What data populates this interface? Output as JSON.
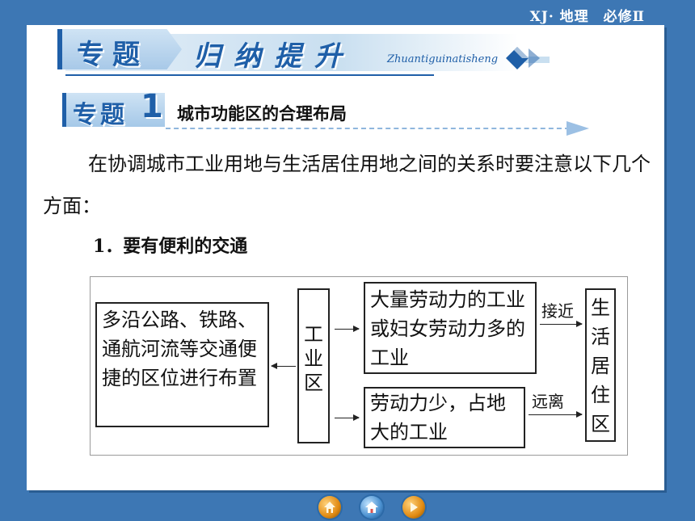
{
  "header": {
    "course_label": "XJ· 地理　必修Ⅱ"
  },
  "banner": {
    "tab": "专题",
    "title": "归纳提升",
    "pinyin": "Zhuantiguinatisheng"
  },
  "section": {
    "tab": "专题",
    "number": "1",
    "title": "城市功能区的合理布局"
  },
  "intro": "在协调城市工业用地与生活居住用地之间的关系时要注意以下几个方面：",
  "point": "1．要有便利的交通",
  "diagram": {
    "left_box": "多沿公路、铁路、通航河流等交通便捷的区位进行布置",
    "middle_box": "工业区",
    "top_box": "大量劳动力的工业或妇女劳动力多的工业",
    "bottom_box": "劳动力少，占地大的工业",
    "right_box": "生活居住区",
    "top_arrow_label": "接近",
    "bottom_arrow_label": "远离"
  },
  "nav": {
    "icons": [
      "home-back-icon",
      "home-icon",
      "forward-icon"
    ]
  },
  "colors": {
    "background": "#3d77b4",
    "accent": "#1f5fa8"
  }
}
